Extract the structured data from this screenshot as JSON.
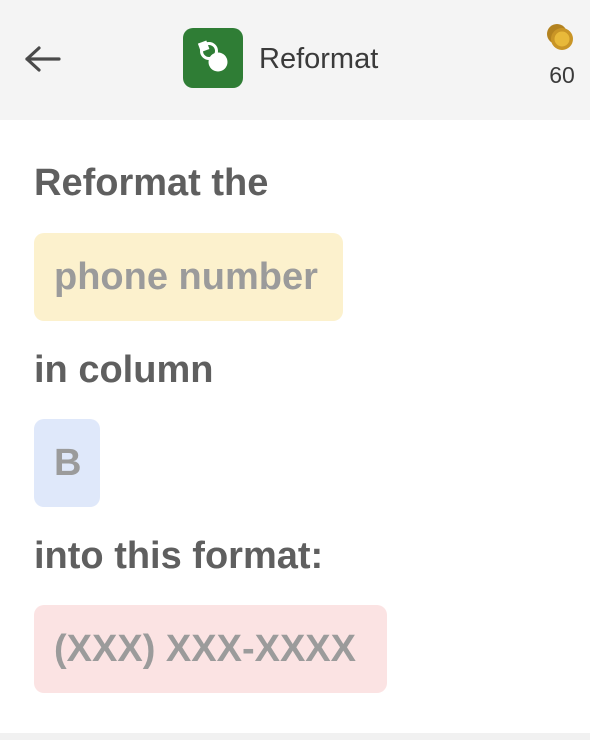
{
  "header": {
    "back_icon": "arrow-left-icon",
    "app_icon": "reformat-app-icon",
    "app_icon_color": "#2f7d35",
    "title": "Reformat",
    "coin_icon": "coins-icon",
    "coin_count": "60"
  },
  "instruction": {
    "line1": "Reformat the",
    "field_value": "phone number",
    "line2": "in column",
    "column_value": "B",
    "line3": "into this format:",
    "format_value": "(XXX) XXX-XXXX"
  },
  "colors": {
    "field_chip_bg": "#fcf1cd",
    "column_chip_bg": "#dfe8fa",
    "format_chip_bg": "#fbe3e3"
  }
}
